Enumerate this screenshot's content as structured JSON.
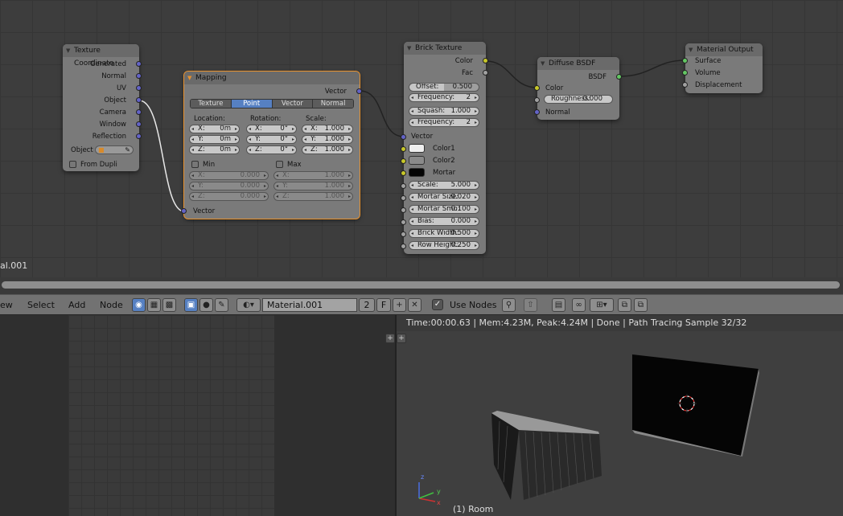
{
  "editor_label": "al.001",
  "nodes": {
    "texture_coordinate": {
      "title": "Texture Coordinate",
      "outputs": [
        "Generated",
        "Normal",
        "UV",
        "Object",
        "Camera",
        "Window",
        "Reflection"
      ],
      "object_label": "Object",
      "from_dupli": "From Dupli"
    },
    "mapping": {
      "title": "Mapping",
      "output": "Vector",
      "tabs": [
        "Texture",
        "Point",
        "Vector",
        "Normal"
      ],
      "active_tab": "Point",
      "location_label": "Location:",
      "rotation_label": "Rotation:",
      "scale_label": "Scale:",
      "location": [
        {
          "l": "X:",
          "v": "0m"
        },
        {
          "l": "Y:",
          "v": "0m"
        },
        {
          "l": "Z:",
          "v": "0m"
        }
      ],
      "rotation": [
        {
          "l": "X:",
          "v": "0°"
        },
        {
          "l": "Y:",
          "v": "0°"
        },
        {
          "l": "Z:",
          "v": "0°"
        }
      ],
      "scale": [
        {
          "l": "X:",
          "v": "1.000"
        },
        {
          "l": "Y:",
          "v": "1.000"
        },
        {
          "l": "Z:",
          "v": "1.000"
        }
      ],
      "min_label": "Min",
      "max_label": "Max",
      "min": [
        {
          "l": "X:",
          "v": "0.000"
        },
        {
          "l": "Y:",
          "v": "0.000"
        },
        {
          "l": "Z:",
          "v": "0.000"
        }
      ],
      "max": [
        {
          "l": "X:",
          "v": "1.000"
        },
        {
          "l": "Y:",
          "v": "1.000"
        },
        {
          "l": "Z:",
          "v": "1.000"
        }
      ],
      "input": "Vector"
    },
    "brick": {
      "title": "Brick Texture",
      "out_color": "Color",
      "out_fac": "Fac",
      "offset": {
        "l": "Offset:",
        "v": "0.500"
      },
      "freq1": {
        "l": "Frequency:",
        "v": "2"
      },
      "squash": {
        "l": "Squash:",
        "v": "1.000"
      },
      "freq2": {
        "l": "Frequency:",
        "v": "2"
      },
      "in_vector": "Vector",
      "color1": "Color1",
      "color2": "Color2",
      "mortar": "Mortar",
      "scale": {
        "l": "Scale:",
        "v": "5.000"
      },
      "mortar_size": {
        "l": "Mortar Size:",
        "v": "0.020"
      },
      "mortar_smooth": {
        "l": "Mortar Smo:",
        "v": "0.100"
      },
      "bias": {
        "l": "Bias:",
        "v": "0.000"
      },
      "brick_width": {
        "l": "Brick Width:",
        "v": "0.500"
      },
      "row_height": {
        "l": "Row Height:",
        "v": "0.250"
      }
    },
    "diffuse": {
      "title": "Diffuse BSDF",
      "out": "BSDF",
      "in_color": "Color",
      "roughness": {
        "l": "Roughness:",
        "v": "0.000"
      },
      "in_normal": "Normal"
    },
    "output": {
      "title": "Material Output",
      "inputs": [
        "Surface",
        "Volume",
        "Displacement"
      ]
    }
  },
  "header": {
    "menus": [
      "ew",
      "Select",
      "Add",
      "Node"
    ],
    "material_name": "Material.001",
    "users": "2",
    "fake_user": "F",
    "use_nodes": "Use Nodes"
  },
  "viewport": {
    "status": "Time:00:00.63 | Mem:4.23M, Peak:4.24M | Done | Path Tracing Sample 32/32",
    "view_name": "(1) Room",
    "axis_x": "x",
    "axis_y": "y",
    "axis_z": "z"
  },
  "colors": {
    "accent": "#5680c2",
    "selected_outline": "#e8922e",
    "socket_vector": "#6363c7",
    "socket_color": "#c7c729",
    "socket_shader": "#63c763"
  }
}
